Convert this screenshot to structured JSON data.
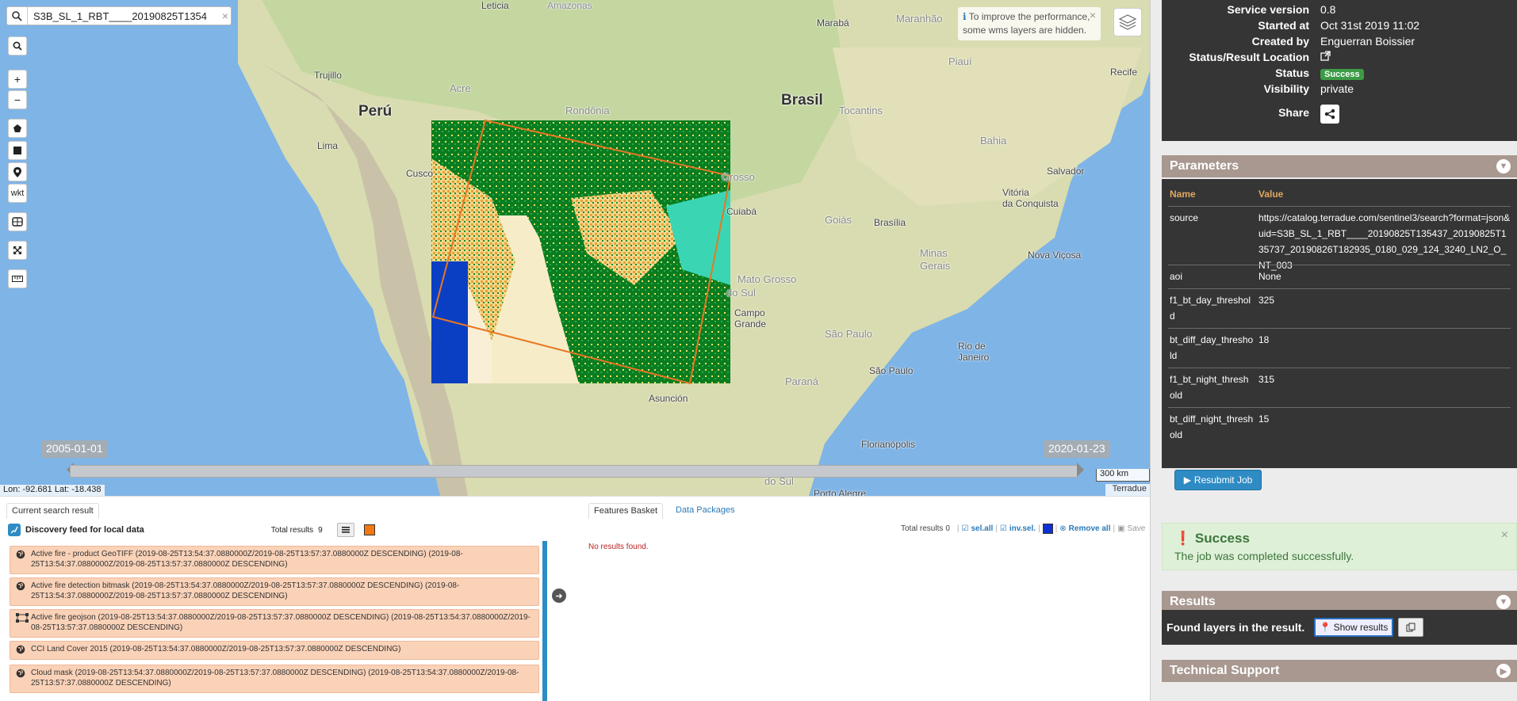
{
  "search": {
    "value": "S3B_SL_1_RBT____20190825T1354"
  },
  "tools": {
    "search": "search-icon",
    "zoom_in": "+",
    "zoom_out": "−",
    "wkt": "wkt"
  },
  "notice": {
    "text": "To improve the performance, some wms layers are hidden."
  },
  "places": {
    "leticia": "Leticia",
    "amazonas": "Amazonas",
    "maraba": "Marabá",
    "maranhao": "Maranhão",
    "piaui": "Piauí",
    "recife": "Recife",
    "trujillo": "Trujillo",
    "peru": "Perú",
    "acre": "Acre",
    "rondonia": "Rondônia",
    "brasil": "Brasil",
    "tocantins": "Tocantins",
    "lima": "Lima",
    "cusco": "Cusco",
    "grosso": "Grosso",
    "cuiaba": "Cuiabá",
    "bahia": "Bahia",
    "salvador": "Salvador",
    "goias": "Goiás",
    "brasilia": "Brasília",
    "vitoria1": "Vitória",
    "vitoria2": "da Conquista",
    "minas": "Minas",
    "gerais": "Gerais",
    "novavicosa": "Nova Viçosa",
    "mgrosso1": "Mato Grosso",
    "mgrosso2": "do Sul",
    "campo1": "Campo",
    "campo2": "Grande",
    "saopaulo_state": "São Paulo",
    "saopaulo": "São Paulo",
    "rio1": "Rio de",
    "rio2": "Janeiro",
    "parana": "Paraná",
    "asuncion": "Asunción",
    "floripa": "Florianópolis",
    "riosul": "do Sul",
    "portoalegre": "Porto Alegre"
  },
  "timeline": {
    "start": "2005-01-01",
    "end": "2020-01-23"
  },
  "coords": "Lon: -92.681 Lat: -18.438",
  "scale": "300 km",
  "attribution": "Terradue",
  "bottom": {
    "tab_current": "Current search result",
    "feed_title": "Discovery feed for local data",
    "total_label": "Total results",
    "total_value": "9",
    "items": [
      {
        "icon": "globe-icon",
        "text": "Active fire - product GeoTIFF (2019-08-25T13:54:37.0880000Z/2019-08-25T13:57:37.0880000Z DESCENDING) (2019-08-25T13:54:37.0880000Z/2019-08-25T13:57:37.0880000Z DESCENDING)"
      },
      {
        "icon": "globe-icon",
        "text": "Active fire detection bitmask (2019-08-25T13:54:37.0880000Z/2019-08-25T13:57:37.0880000Z DESCENDING) (2019-08-25T13:54:37.0880000Z/2019-08-25T13:57:37.0880000Z DESCENDING)"
      },
      {
        "icon": "polygon-icon",
        "text": "Active fire geojson (2019-08-25T13:54:37.0880000Z/2019-08-25T13:57:37.0880000Z DESCENDING) (2019-08-25T13:54:37.0880000Z/2019-08-25T13:57:37.0880000Z DESCENDING)"
      },
      {
        "icon": "globe-icon",
        "text": "CCI Land Cover 2015 (2019-08-25T13:54:37.0880000Z/2019-08-25T13:57:37.0880000Z DESCENDING)"
      },
      {
        "icon": "globe-icon",
        "text": "Cloud mask (2019-08-25T13:54:37.0880000Z/2019-08-25T13:57:37.0880000Z DESCENDING) (2019-08-25T13:54:37.0880000Z/2019-08-25T13:57:37.0880000Z DESCENDING)"
      }
    ],
    "tab_basket": "Features Basket",
    "tab_packages": "Data Packages",
    "basket_total_label": "Total results",
    "basket_total_value": "0",
    "sel_all": "sel.all",
    "inv_sel": "inv.sel.",
    "remove_all": "Remove all",
    "save": "Save",
    "no_results": "No results found."
  },
  "info": [
    {
      "k": "Service version",
      "v": "0.8"
    },
    {
      "k": "Started at",
      "v": "Oct 31st 2019 11:02"
    },
    {
      "k": "Created by",
      "v": "Enguerran Boissier"
    },
    {
      "k": "Status/Result Location",
      "v": ""
    },
    {
      "k": "Status",
      "v": "Success"
    },
    {
      "k": "Visibility",
      "v": "private"
    },
    {
      "k": "Share",
      "v": ""
    }
  ],
  "parameters": {
    "title": "Parameters",
    "col_name": "Name",
    "col_value": "Value",
    "rows": [
      {
        "name": "source",
        "value": "https://catalog.terradue.com/sentinel3/search?format=json&uid=S3B_SL_1_RBT____20190825T135437_20190825T135737_20190826T182935_0180_029_124_3240_LN2_O_NT_003"
      },
      {
        "name": "aoi",
        "value": "None"
      },
      {
        "name": "f1_bt_day_threshold",
        "value": "325"
      },
      {
        "name": "bt_diff_day_threshold",
        "value": "18"
      },
      {
        "name": "f1_bt_night_threshold",
        "value": "315"
      },
      {
        "name": "bt_diff_night_threshold",
        "value": "15"
      }
    ]
  },
  "resubmit": "Resubmit Job",
  "alert": {
    "title": "Success",
    "message": "The job was completed successfully."
  },
  "results": {
    "title": "Results",
    "found": "Found layers in the result.",
    "show": "Show results"
  },
  "support": {
    "title": "Technical Support"
  },
  "colors": {
    "accent": "#2e8bc4",
    "panel_dark": "#353535",
    "section_head": "#a89890",
    "result_item": "#fad2b8",
    "success": "#3c9b46"
  }
}
